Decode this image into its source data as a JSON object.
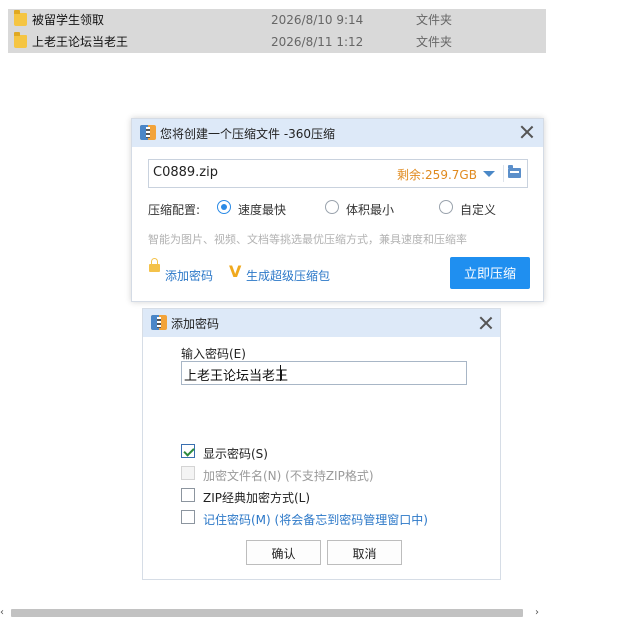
{
  "explorer": {
    "rows": [
      {
        "name": "被留学生领取",
        "date": "2026/8/10 9:14",
        "type": "文件夹"
      },
      {
        "name": "上老王论坛当老王",
        "date": "2026/8/11 1:12",
        "type": "文件夹"
      }
    ]
  },
  "zip_dialog": {
    "title": "您将创建一个压缩文件 -360压缩",
    "filename": "C0889.zip",
    "free_space": "剩余:259.7GB",
    "config_label": "压缩配置:",
    "options": [
      {
        "label": "速度最快",
        "selected": true
      },
      {
        "label": "体积最小",
        "selected": false
      },
      {
        "label": "自定义",
        "selected": false
      }
    ],
    "hint": "智能为图片、视频、文档等挑选最优压缩方式，兼具速度和压缩率",
    "add_password": "添加密码",
    "super_package": "生成超级压缩包",
    "compress_button": "立即压缩"
  },
  "password_dialog": {
    "title": "添加密码",
    "input_label": "输入密码(E)",
    "password_value": "上老王论坛当老王",
    "checkboxes": [
      {
        "label": "显示密码(S)",
        "checked": true,
        "disabled": false
      },
      {
        "label": "加密文件名(N) (不支持ZIP格式)",
        "checked": false,
        "disabled": true
      },
      {
        "label": "ZIP经典加密方式(L)",
        "checked": false,
        "disabled": false
      },
      {
        "label": "记住密码(M) (将会备忘到密码管理窗口中)",
        "checked": false,
        "disabled": false
      }
    ],
    "ok_button": "确认",
    "cancel_button": "取消"
  },
  "scrollbar": {
    "left_arrow": "‹",
    "right_arrow": "›"
  }
}
